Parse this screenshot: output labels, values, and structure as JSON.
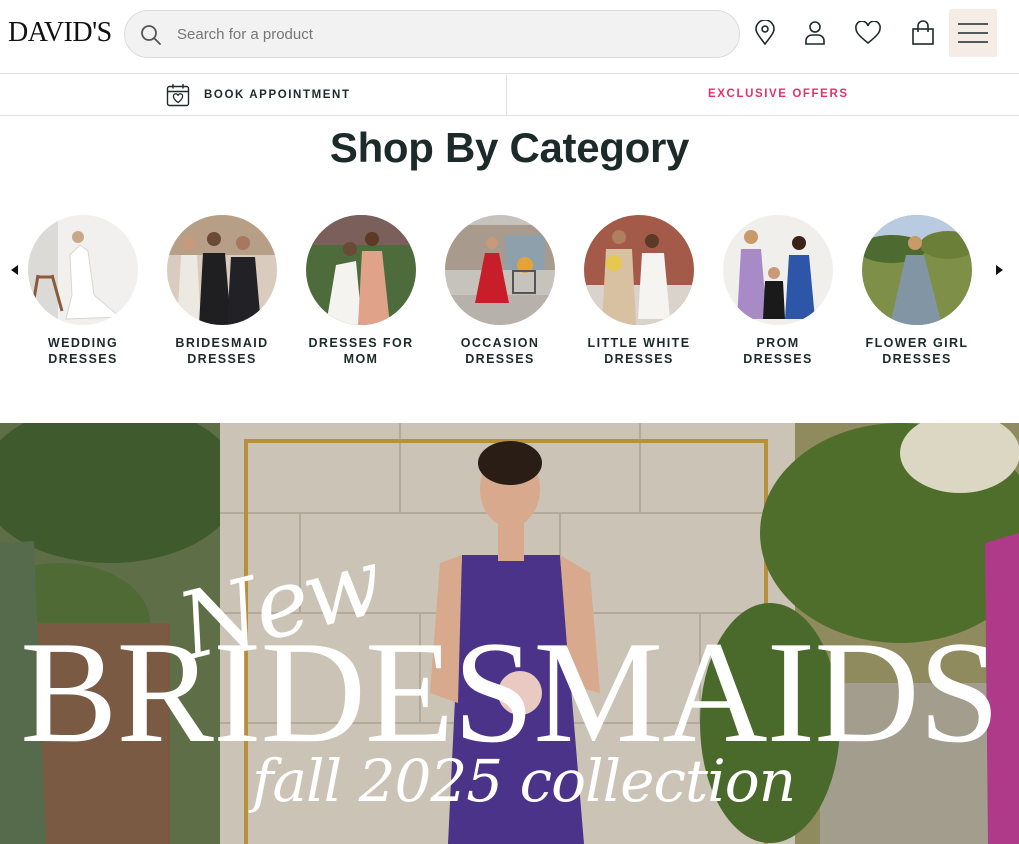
{
  "header": {
    "logo": "DAVID'S",
    "search_placeholder": "Search for a product",
    "icons": [
      "location-icon",
      "account-icon",
      "wishlist-heart-icon",
      "shopping-bag-icon",
      "menu-icon"
    ]
  },
  "subbar": {
    "book_label": "BOOK APPOINTMENT",
    "offers_label": "EXCLUSIVE OFFERS",
    "offers_color": "#e5316b"
  },
  "category": {
    "title": "Shop By Category",
    "items": [
      {
        "line1": "WEDDING",
        "line2": "DRESSES"
      },
      {
        "line1": "BRIDESMAID",
        "line2": "DRESSES"
      },
      {
        "line1": "DRESSES FOR",
        "line2": "MOM"
      },
      {
        "line1": "OCCASION",
        "line2": "DRESSES"
      },
      {
        "line1": "LITTLE WHITE",
        "line2": "DRESSES"
      },
      {
        "line1": "PROM",
        "line2": "DRESSES"
      },
      {
        "line1": "FLOWER GIRL",
        "line2": "DRESSES"
      }
    ]
  },
  "hero": {
    "script": "New",
    "title": "BRIDESMAIDS",
    "subtitle": "fall 2025 collection"
  }
}
